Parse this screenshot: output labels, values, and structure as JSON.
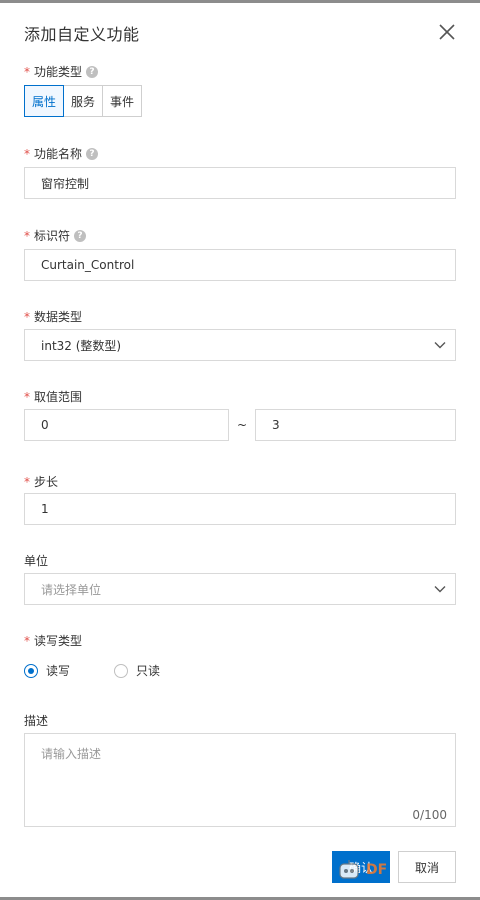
{
  "dialog": {
    "title": "添加自定义功能"
  },
  "fields": {
    "func_type": {
      "label": "功能类型",
      "options": [
        "属性",
        "服务",
        "事件"
      ],
      "selected": "属性"
    },
    "func_name": {
      "label": "功能名称",
      "value": "窗帘控制"
    },
    "identifier": {
      "label": "标识符",
      "value": "Curtain_Control"
    },
    "data_type": {
      "label": "数据类型",
      "value": "int32 (整数型)"
    },
    "range": {
      "label": "取值范围",
      "min": "0",
      "separator": "~",
      "max": "3"
    },
    "step": {
      "label": "步长",
      "value": "1"
    },
    "unit": {
      "label": "单位",
      "placeholder": "请选择单位"
    },
    "rw_type": {
      "label": "读写类型",
      "options": [
        "读写",
        "只读"
      ],
      "selected": "读写"
    },
    "description": {
      "label": "描述",
      "placeholder": "请输入描述",
      "counter": "0/100"
    }
  },
  "footer": {
    "confirm_label": "确认",
    "cancel_label": "取消"
  },
  "watermark": {
    "text": "DF"
  },
  "colors": {
    "primary": "#0070cc",
    "required": "#e1504a",
    "border": "#d9d9d9",
    "placeholder": "#999999"
  }
}
